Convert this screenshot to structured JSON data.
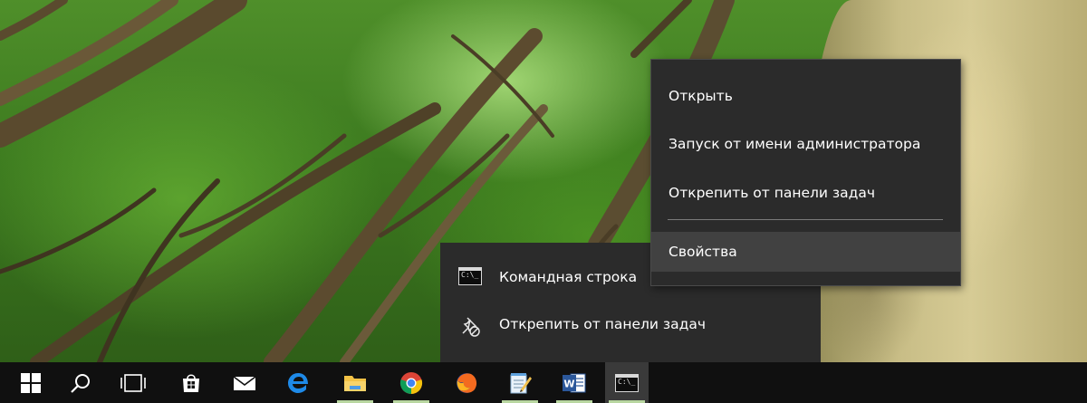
{
  "context_menu": {
    "items": [
      {
        "label": "Открыть"
      },
      {
        "label": "Запуск от имени администратора"
      },
      {
        "label": "Открепить от панели задач"
      },
      {
        "label": "Свойства",
        "hovered": true
      }
    ]
  },
  "jump_list": {
    "items": [
      {
        "label": "Командная строка",
        "icon": "cmd-icon"
      },
      {
        "label": "Открепить от панели задач",
        "icon": "unpin-icon"
      }
    ]
  },
  "taskbar": {
    "buttons": [
      {
        "name": "start-button",
        "icon": "windows-logo-icon"
      },
      {
        "name": "search-button",
        "icon": "search-icon"
      },
      {
        "name": "task-view-button",
        "icon": "task-view-icon"
      },
      {
        "name": "store-button",
        "icon": "store-icon"
      },
      {
        "name": "mail-button",
        "icon": "mail-icon"
      },
      {
        "name": "edge-button",
        "icon": "edge-icon"
      },
      {
        "name": "file-explorer-button",
        "icon": "folder-icon",
        "running": true
      },
      {
        "name": "chrome-button",
        "icon": "chrome-icon",
        "running": true
      },
      {
        "name": "firefox-button",
        "icon": "firefox-icon"
      },
      {
        "name": "notepad-button",
        "icon": "notepad-icon",
        "running": true
      },
      {
        "name": "word-button",
        "icon": "word-icon",
        "running": true
      },
      {
        "name": "cmd-button",
        "icon": "cmd-icon",
        "active": true
      }
    ],
    "cmd_icon_text": "C:\\_"
  },
  "colors": {
    "menu_bg": "#2b2b2b",
    "menu_hover": "#414141",
    "taskbar_bg": "#101010",
    "running_indicator": "#b8d6a0"
  }
}
